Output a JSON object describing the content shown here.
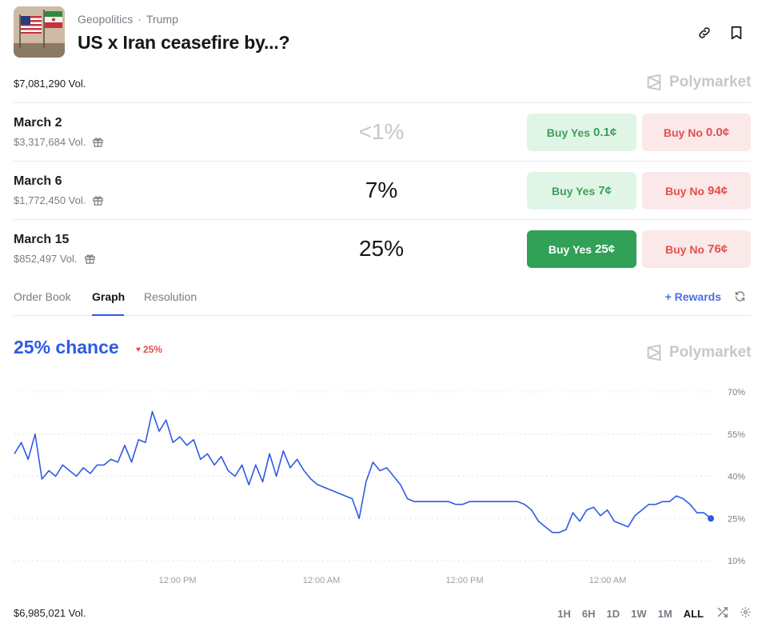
{
  "header": {
    "category": "Geopolitics",
    "separator": "·",
    "tag": "Trump",
    "title": "US x Iran ceasefire by...?"
  },
  "brand": "Polymarket",
  "total_volume": "$7,081,290 Vol.",
  "markets": [
    {
      "date": "March 2",
      "volume": "$3,317,684 Vol.",
      "chance": "<1%",
      "yes_label": "Buy Yes",
      "yes_price": "0.1¢",
      "no_label": "Buy No",
      "no_price": "0.0¢"
    },
    {
      "date": "March 6",
      "volume": "$1,772,450 Vol.",
      "chance": "7%",
      "yes_label": "Buy Yes",
      "yes_price": "7¢",
      "no_label": "Buy No",
      "no_price": "94¢"
    },
    {
      "date": "March 15",
      "volume": "$852,497 Vol.",
      "chance": "25%",
      "yes_label": "Buy Yes",
      "yes_price": "25¢",
      "no_label": "Buy No",
      "no_price": "76¢"
    }
  ],
  "tabs": [
    "Order Book",
    "Graph",
    "Resolution"
  ],
  "active_tab": "Graph",
  "rewards_label": "+ Rewards",
  "chance_text": "25% chance",
  "change_text": "25%",
  "graph_volume": "$6,985,021 Vol.",
  "ranges": [
    "1H",
    "6H",
    "1D",
    "1W",
    "1M",
    "ALL"
  ],
  "active_range": "ALL",
  "colors": {
    "line": "#2d5be3",
    "yes": "#30a157",
    "no": "#e0514f"
  },
  "chart_data": {
    "type": "line",
    "yticks": [
      "70%",
      "55%",
      "40%",
      "25%",
      "10%"
    ],
    "ylim": [
      10,
      70
    ],
    "xticks": [
      "12:00 PM",
      "12:00 AM",
      "12:00 PM",
      "12:00 AM"
    ],
    "series": [
      {
        "values": [
          48,
          52,
          46,
          55,
          39,
          42,
          40,
          44,
          42,
          40,
          43,
          41,
          44,
          44,
          46,
          45,
          51,
          45,
          53,
          52,
          63,
          56,
          60,
          52,
          54,
          51,
          53,
          46,
          48,
          44,
          47,
          42,
          40,
          44,
          37,
          44,
          38,
          48,
          40,
          49,
          43,
          46,
          42,
          39,
          37,
          36,
          35,
          34,
          33,
          32,
          25,
          38,
          45,
          42,
          43,
          40,
          37,
          32,
          31,
          31,
          31,
          31,
          31,
          31,
          30,
          30,
          31,
          31,
          31,
          31,
          31,
          31,
          31,
          31,
          30,
          28,
          24,
          22,
          20,
          20,
          21,
          27,
          24,
          28,
          29,
          26,
          28,
          24,
          23,
          22,
          26,
          28,
          30,
          30,
          31,
          31,
          33,
          32,
          30,
          27,
          27,
          25
        ]
      }
    ],
    "last_point": 25
  }
}
